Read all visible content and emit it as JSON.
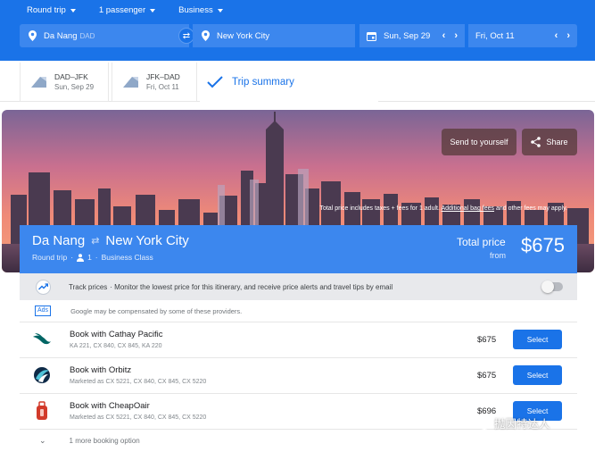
{
  "top": {
    "trip_type": "Round trip",
    "passengers": "1 passenger",
    "cabin": "Business",
    "origin_city": "Da Nang",
    "origin_code": "DAD",
    "destination": "New York City",
    "depart_date": "Sun, Sep 29",
    "return_date": "Fri, Oct 11",
    "prev_arrow": "‹",
    "next_arrow": "›"
  },
  "trip_tabs": [
    {
      "route": "DAD–JFK",
      "date": "Sun, Sep 29"
    },
    {
      "route": "JFK–DAD",
      "date": "Fri, Oct 11"
    },
    {
      "label": "Trip summary"
    }
  ],
  "hero": {
    "send_label": "Send to yourself",
    "share_label": "Share",
    "note_pre": "Total price includes taxes + fees for 1 adult.",
    "note_link": "Additional bag fees",
    "note_post": "and other fees may apply."
  },
  "summary": {
    "origin": "Da Nang",
    "destination": "New York City",
    "trip_type": "Round trip",
    "passengers": "1",
    "cabin": "Business Class",
    "total_label": "Total price",
    "from_label": "from",
    "total_price": "$675"
  },
  "track": {
    "title": "Track prices",
    "text": "· Monitor the lowest price for this itinerary, and receive price alerts and travel tips by email"
  },
  "ads": {
    "badge": "Ads",
    "text": "Google may be compensated by some of these providers."
  },
  "options": [
    {
      "provider": "Book with Cathay Pacific",
      "detail": "KA 221, CX 840, CX 845, KA 220",
      "price": "$675",
      "button": "Select"
    },
    {
      "provider": "Book with Orbitz",
      "detail": "Marketed as CX 5221, CX 840, CX 845, CX 5220",
      "price": "$675",
      "button": "Select"
    },
    {
      "provider": "Book with CheapOair",
      "detail": "Marketed as CX 5221, CX 840, CX 845, CX 5220",
      "price": "$696",
      "button": "Select"
    }
  ],
  "more_options": "1 more booking option",
  "watermark": "抛因特达人",
  "colors": {
    "accent": "#1a73e8",
    "card": "#3c87ee"
  }
}
